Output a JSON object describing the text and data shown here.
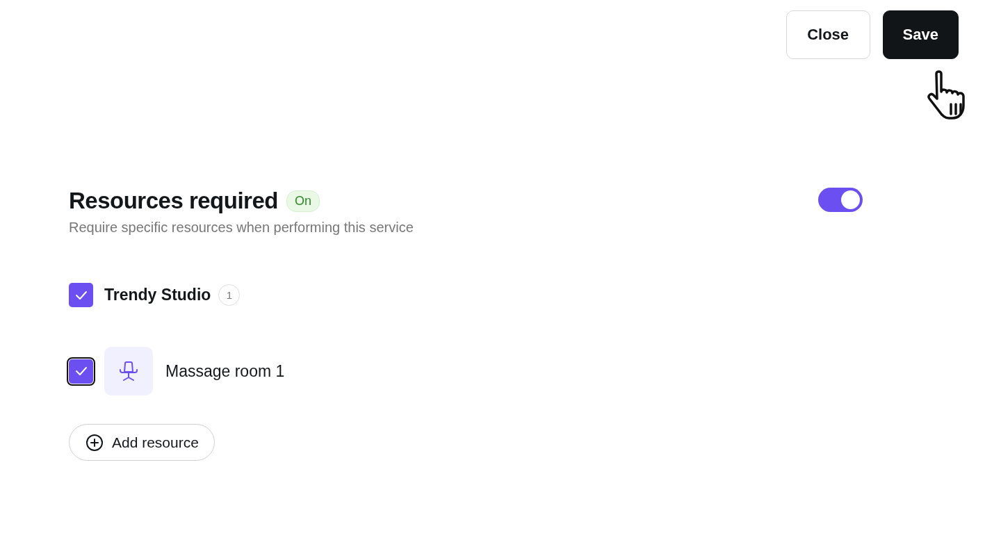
{
  "header": {
    "buttons": [
      {
        "label": "Close",
        "kind": "secondary"
      },
      {
        "label": "Save",
        "kind": "primary"
      }
    ]
  },
  "section": {
    "title": "Resources required",
    "badge": "On",
    "description": "Require specific resources when performing this service",
    "toggle": {
      "on": true
    }
  },
  "groups": [
    {
      "name": "Trendy Studio",
      "count": "1",
      "checked": true,
      "resources": [
        {
          "name": "Massage room 1",
          "checked": true,
          "focused": true
        }
      ]
    }
  ],
  "add_button": {
    "label": "Add resource"
  }
}
